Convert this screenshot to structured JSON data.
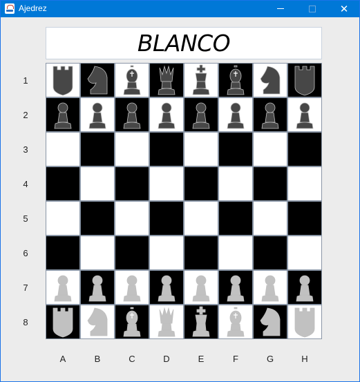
{
  "window": {
    "title": "Ajedrez"
  },
  "turn_label": "BLANCO",
  "rows": [
    "1",
    "2",
    "3",
    "4",
    "5",
    "6",
    "7",
    "8"
  ],
  "cols": [
    "A",
    "B",
    "C",
    "D",
    "E",
    "F",
    "G",
    "H"
  ],
  "colors": {
    "dark_pieces": "#474747",
    "light_pieces": "#c1c1c1",
    "dark_square": "#000000",
    "light_square": "#ffffff",
    "titlebar": "#0078d7"
  },
  "board": [
    [
      "rook",
      "knight",
      "bishop",
      "queen",
      "king",
      "bishop",
      "knight",
      "rook"
    ],
    [
      "pawn",
      "pawn",
      "pawn",
      "pawn",
      "pawn",
      "pawn",
      "pawn",
      "pawn"
    ],
    [
      "",
      "",
      "",
      "",
      "",
      "",
      "",
      ""
    ],
    [
      "",
      "",
      "",
      "",
      "",
      "",
      "",
      ""
    ],
    [
      "",
      "",
      "",
      "",
      "",
      "",
      "",
      ""
    ],
    [
      "",
      "",
      "",
      "",
      "",
      "",
      "",
      ""
    ],
    [
      "pawn",
      "pawn",
      "pawn",
      "pawn",
      "pawn",
      "pawn",
      "pawn",
      "pawn"
    ],
    [
      "rook",
      "knight",
      "bishop",
      "queen",
      "king",
      "bishop",
      "knight",
      "rook"
    ]
  ],
  "piece_colors": [
    [
      "dark",
      "dark",
      "dark",
      "dark",
      "dark",
      "dark",
      "dark",
      "dark"
    ],
    [
      "dark",
      "dark",
      "dark",
      "dark",
      "dark",
      "dark",
      "dark",
      "dark"
    ],
    [
      "",
      "",
      "",
      "",
      "",
      "",
      "",
      ""
    ],
    [
      "",
      "",
      "",
      "",
      "",
      "",
      "",
      ""
    ],
    [
      "",
      "",
      "",
      "",
      "",
      "",
      "",
      ""
    ],
    [
      "",
      "",
      "",
      "",
      "",
      "",
      "",
      ""
    ],
    [
      "light",
      "light",
      "light",
      "light",
      "light",
      "light",
      "light",
      "light"
    ],
    [
      "light",
      "light",
      "light",
      "light",
      "light",
      "light",
      "light",
      "light"
    ]
  ]
}
